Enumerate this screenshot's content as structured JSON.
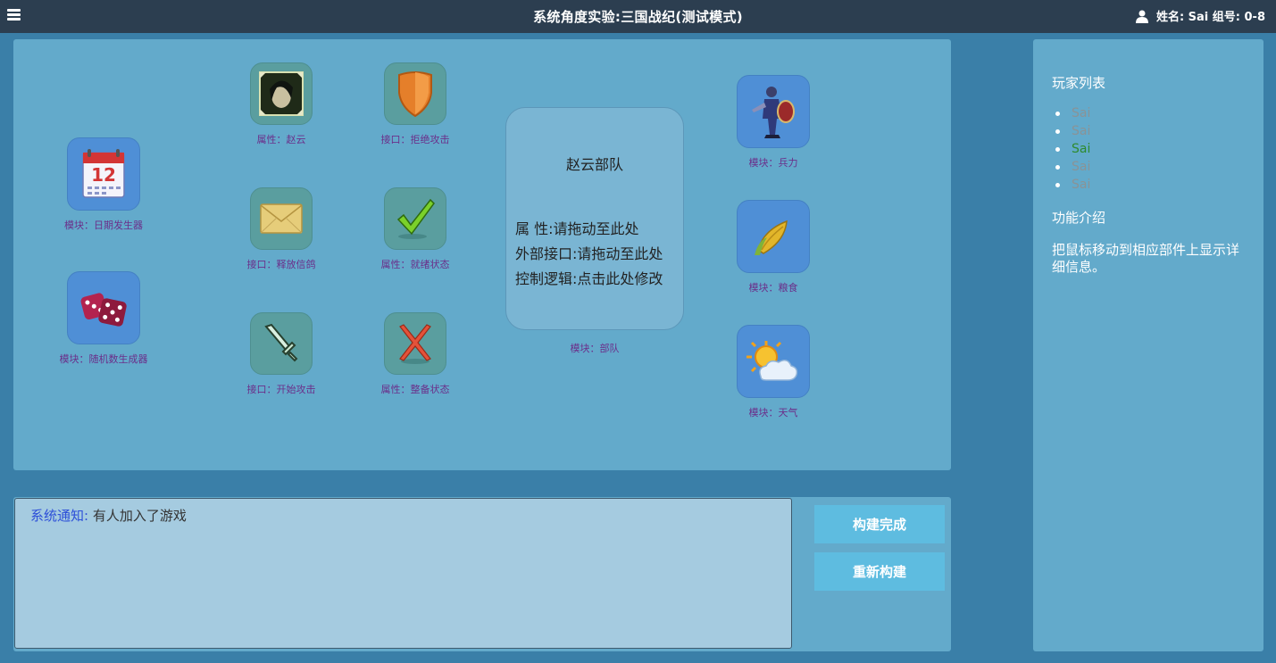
{
  "header": {
    "title": "系统角度实验:三国战纪(测试模式)",
    "user_label": "姓名: Sai 组号: 0-8",
    "menu_icon": "hamburger-icon",
    "user_icon": "person-icon"
  },
  "components": {
    "date_generator": "模块：日期发生器",
    "random_generator": "模块：随机数生成器",
    "zhaoyun_attr": "属性：赵云",
    "release_pigeon": "接口：释放信鸽",
    "start_attack": "接口：开始攻击",
    "reject_attack": "接口：拒绝攻击",
    "ready_state": "属性：就绪状态",
    "prep_state": "属性：整备状态",
    "troops": "模块：兵力",
    "grain": "模块：粮食",
    "weather": "模块：天气"
  },
  "army": {
    "name": "赵云部队",
    "attr_line": "属        性:请拖动至此处",
    "iface_line": "外部接口:请拖动至此处",
    "logic_line": "控制逻辑:点击此处修改",
    "caption": "模块：部队"
  },
  "log": {
    "label": "系统通知:",
    "text": " 有人加入了游戏"
  },
  "buttons": {
    "build_done": "构建完成",
    "rebuild": "重新构建"
  },
  "sidebar": {
    "players_title": "玩家列表",
    "players": [
      {
        "name": "Sai",
        "color": "#8a9396"
      },
      {
        "name": "Sai",
        "color": "#8a9396"
      },
      {
        "name": "Sai",
        "color": "#2e8b2e"
      },
      {
        "name": "Sai",
        "color": "#8a9396"
      },
      {
        "name": "Sai",
        "color": "#8a9396"
      }
    ],
    "intro_title": "功能介绍",
    "intro_text": "把鼠标移动到相应部件上显示详细信息。"
  }
}
